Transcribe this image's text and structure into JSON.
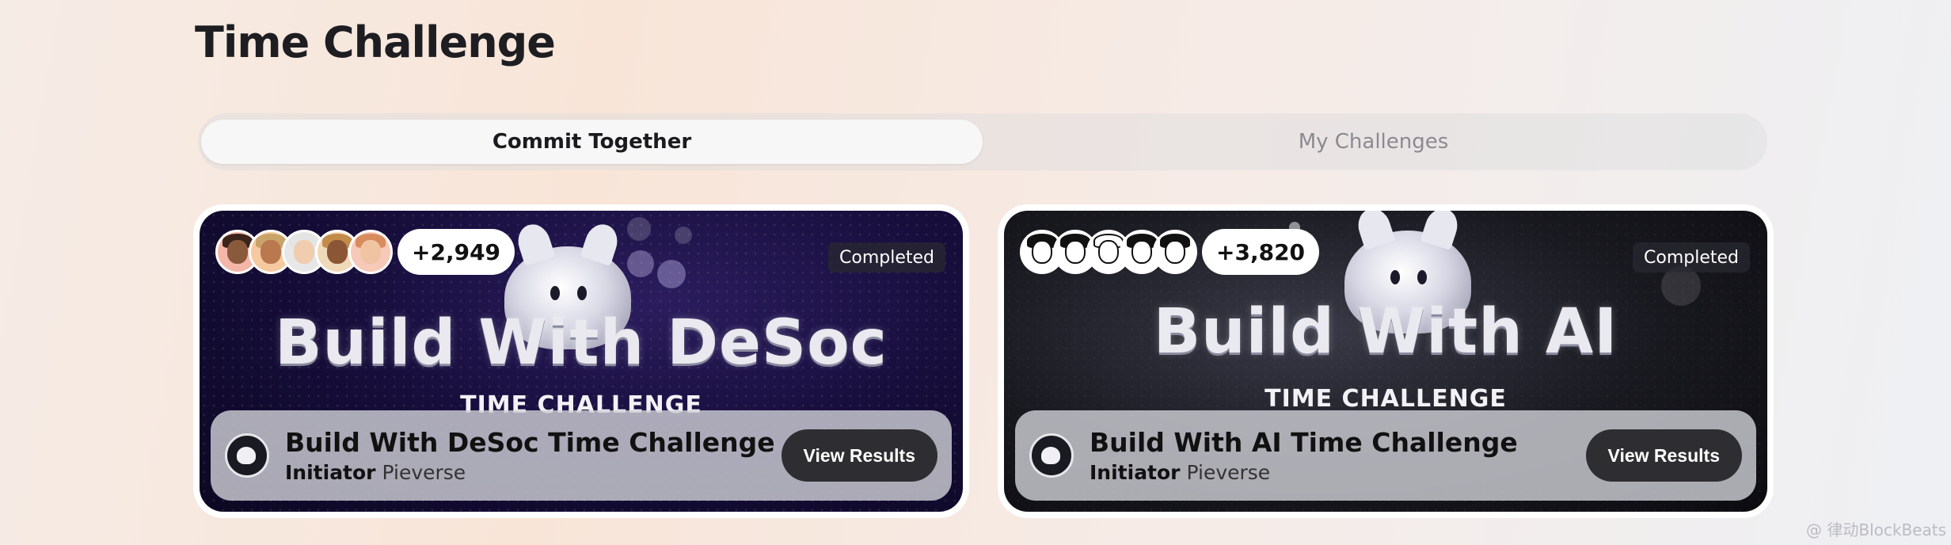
{
  "page": {
    "title": "Time Challenge"
  },
  "tabs": [
    {
      "label": "Commit Together",
      "active": true
    },
    {
      "label": "My Challenges",
      "active": false
    }
  ],
  "challenges": [
    {
      "banner_title": "Build With DeSoc",
      "banner_subtitle": "TIME CHALLENGE",
      "participant_count": "+2,949",
      "status": "Completed",
      "title": "Build With DeSoc Time Challenge",
      "initiator_label": "Initiator",
      "initiator_name": "Pieverse",
      "action_label": "View Results"
    },
    {
      "banner_title": "Build With AI",
      "banner_subtitle": "TIME CHALLENGE",
      "participant_count": "+3,820",
      "status": "Completed",
      "title": "Build With AI Time Challenge",
      "initiator_label": "Initiator",
      "initiator_name": "Pieverse",
      "action_label": "View Results"
    }
  ],
  "watermark": "@ 律动BlockBeats",
  "colors": {
    "active_tab_bg": "#f7f7f8",
    "button_bg": "#2e2e32",
    "desoc_banner": "#160d3a",
    "ai_banner": "#18181f"
  }
}
